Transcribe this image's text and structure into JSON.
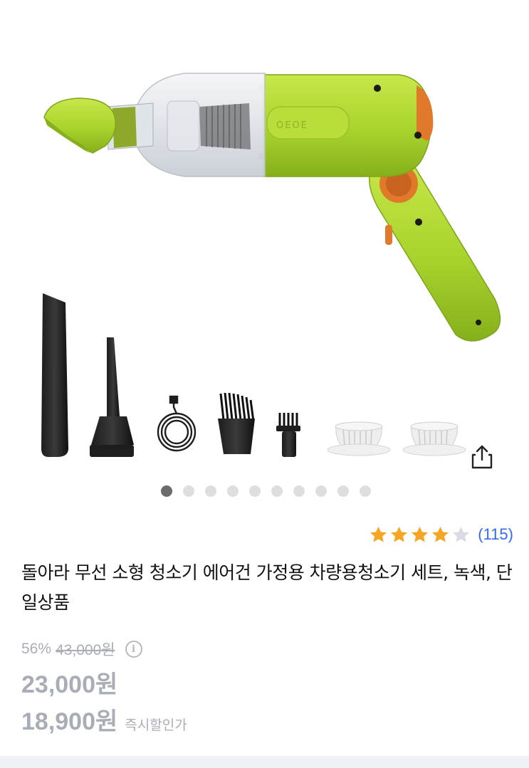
{
  "product": {
    "title": "돌아라 무선 소형 청소기 에어건 가정용 차량용청소기 세트, 녹색, 단일상품",
    "rating": 4,
    "rating_max": 5,
    "review_count": "(115)"
  },
  "gallery": {
    "dot_count": 10,
    "active_index": 0,
    "share_icon": "share-icon"
  },
  "pricing": {
    "discount_rate": "56%",
    "original_price": "43,000원",
    "sale_price": "23,000원",
    "instant_price": "18,900원",
    "instant_label": "즉시할인가",
    "info_icon": "info-icon"
  },
  "colors": {
    "body_green": "#a8d32c",
    "accent_orange": "#e07a2a",
    "star_filled": "#f5a623",
    "star_empty": "#d9dde3",
    "link_blue": "#346aff",
    "muted_gray": "#a8adb6"
  }
}
